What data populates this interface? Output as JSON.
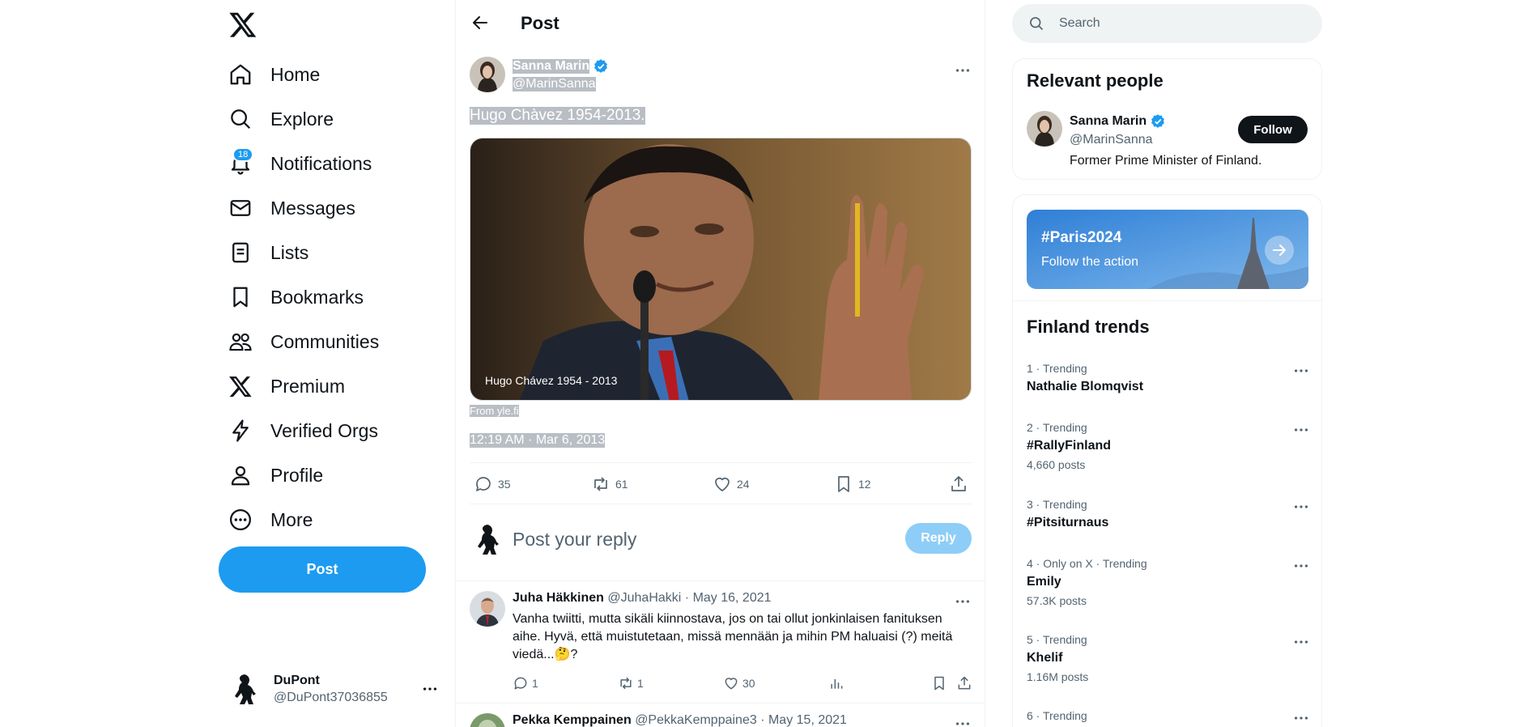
{
  "nav": {
    "items": [
      {
        "label": "Home",
        "icon": "home-icon"
      },
      {
        "label": "Explore",
        "icon": "search-icon"
      },
      {
        "label": "Notifications",
        "icon": "bell-icon",
        "badge": "18"
      },
      {
        "label": "Messages",
        "icon": "envelope-icon"
      },
      {
        "label": "Lists",
        "icon": "list-icon"
      },
      {
        "label": "Bookmarks",
        "icon": "bookmark-icon"
      },
      {
        "label": "Communities",
        "icon": "people-icon"
      },
      {
        "label": "Premium",
        "icon": "x-logo-icon"
      },
      {
        "label": "Verified Orgs",
        "icon": "lightning-icon"
      },
      {
        "label": "Profile",
        "icon": "person-icon"
      },
      {
        "label": "More",
        "icon": "more-circle-icon"
      }
    ],
    "post_button": "Post",
    "account": {
      "name": "DuPont",
      "handle": "@DuPont37036855"
    }
  },
  "header": {
    "title": "Post"
  },
  "post": {
    "author": "Sanna Marin",
    "handle": "@MarinSanna",
    "text": "Hugo Chàvez 1954-2013.",
    "media_caption": "Hugo Chávez 1954 - 2013",
    "source": "From yle.fi",
    "timestamp": "12:19 AM · Mar 6, 2013",
    "stats": {
      "replies": "35",
      "reposts": "61",
      "likes": "24",
      "bookmarks": "12"
    }
  },
  "reply_box": {
    "placeholder": "Post your reply",
    "button": "Reply"
  },
  "replies": [
    {
      "name": "Juha Häkkinen",
      "handle": "@JuhaHakki",
      "date": "· May 16, 2021",
      "text": "Vanha twiitti, mutta sikäli kiinnostava, jos on tai ollut jonkinlaisen fanituksen aihe. Hyvä, että muistutetaan, missä mennään ja mihin PM haluaisi (?) meitä viedä...🤔?",
      "replies": "1",
      "reposts": "1",
      "likes": "30"
    },
    {
      "name": "Pekka Kemppainen",
      "handle": "@PekkaKemppaine3",
      "date": "· May 15, 2021"
    }
  ],
  "search": {
    "placeholder": "Search"
  },
  "relevant": {
    "title": "Relevant people",
    "name": "Sanna Marin",
    "handle": "@MarinSanna",
    "bio": "Former Prime Minister of Finland.",
    "follow": "Follow"
  },
  "promo": {
    "tag": "#Paris2024",
    "sub": "Follow the action"
  },
  "trends": {
    "title": "Finland trends",
    "items": [
      {
        "meta": "1 · Trending",
        "name": "Nathalie Blomqvist",
        "count": ""
      },
      {
        "meta": "2 · Trending",
        "name": "#RallyFinland",
        "count": "4,660 posts"
      },
      {
        "meta": "3 · Trending",
        "name": "#Pitsiturnaus",
        "count": ""
      },
      {
        "meta": "4 · Only on X · Trending",
        "name": "Emily",
        "count": "57.3K posts"
      },
      {
        "meta": "5 · Trending",
        "name": "Khelif",
        "count": "1.16M posts"
      },
      {
        "meta": "6 · Trending",
        "name": "",
        "count": ""
      }
    ]
  },
  "colors": {
    "accent": "#1d9bf0",
    "text": "#0f1419",
    "muted": "#536471",
    "border": "#eff3f4"
  }
}
